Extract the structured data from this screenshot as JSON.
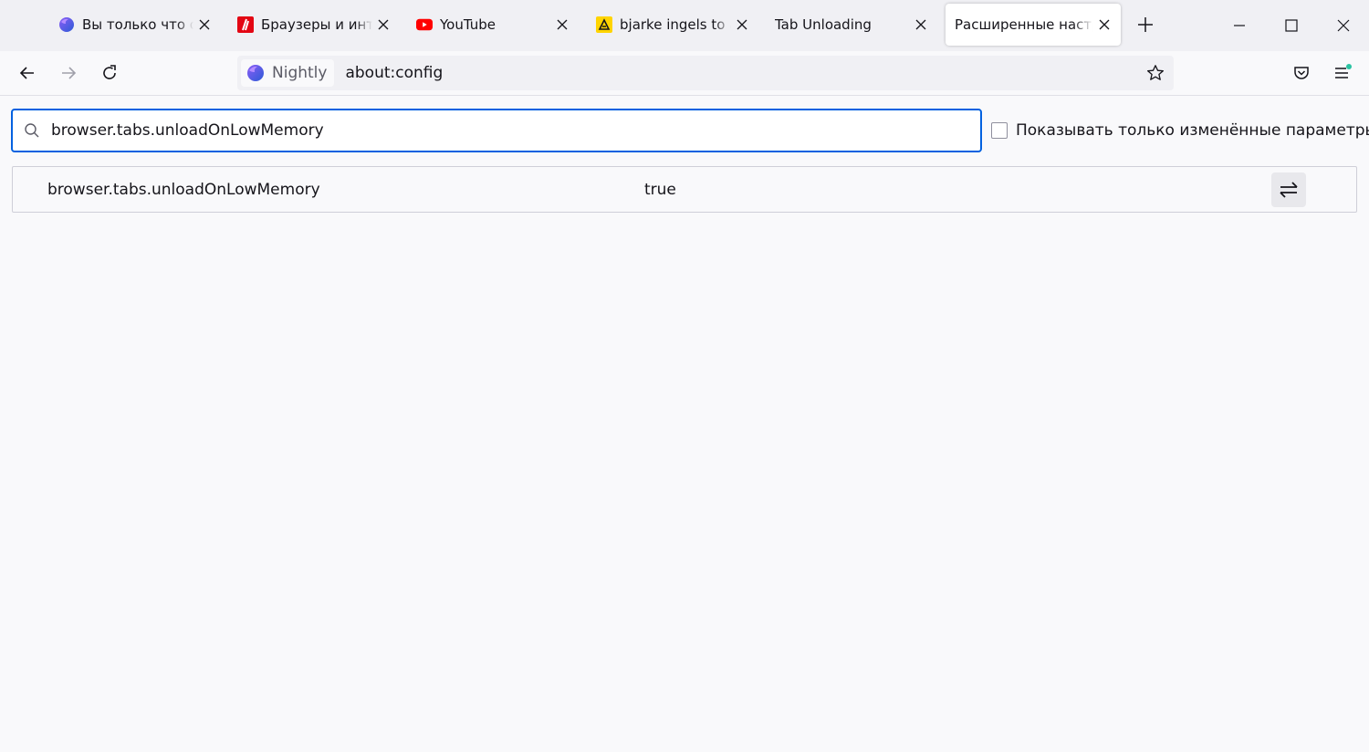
{
  "tabs": [
    {
      "title": "Вы только что обн",
      "icon": "firefox-nightly-icon",
      "active": false
    },
    {
      "title": "Браузеры и интер",
      "icon": "news-site-icon",
      "active": false
    },
    {
      "title": "YouTube",
      "icon": "youtube-icon",
      "active": false
    },
    {
      "title": "bjarke ingels to act",
      "icon": "site-icon",
      "active": false
    },
    {
      "title": "Tab Unloading",
      "icon": "none",
      "active": false
    },
    {
      "title": "Расширенные настро",
      "icon": "none",
      "active": true
    }
  ],
  "navbar": {
    "identity_label": "Nightly",
    "url": "about:config"
  },
  "search": {
    "value": "browser.tabs.unloadOnLowMemory"
  },
  "filter": {
    "label": "Показывать только изменённые параметры",
    "checked": false
  },
  "prefs": [
    {
      "name": "browser.tabs.unloadOnLowMemory",
      "value": "true"
    }
  ],
  "colors": {
    "accent": "#0061e0",
    "youtube": "#ff0000",
    "tabstrip": "#f0f0f4"
  }
}
